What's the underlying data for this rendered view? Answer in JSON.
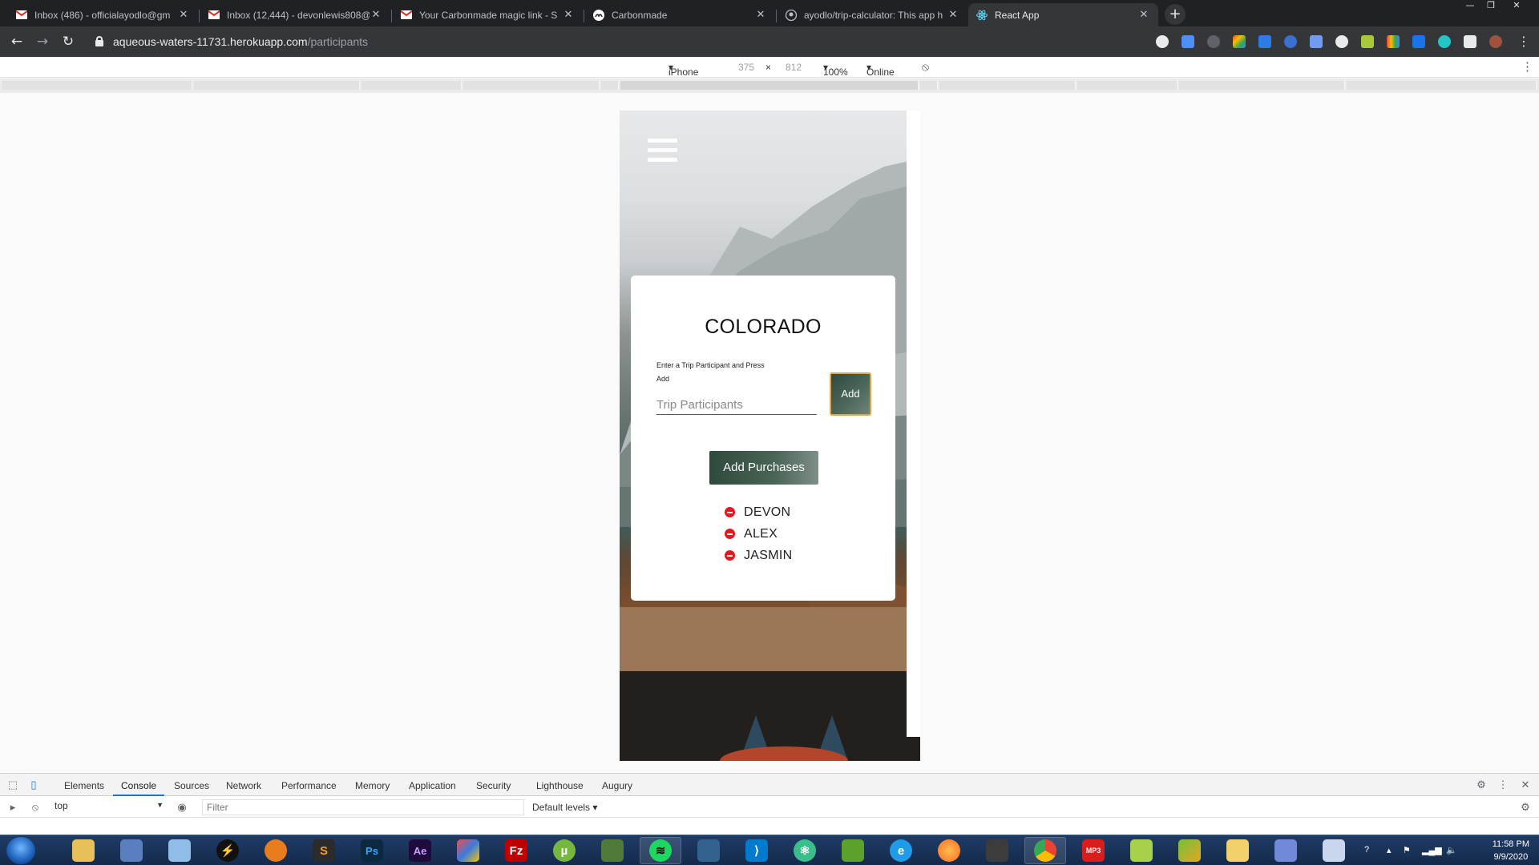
{
  "browser": {
    "tabs": [
      {
        "title": "Inbox (486) - officialayodlo@gm",
        "favicon": "gmail-icon",
        "active": false
      },
      {
        "title": "Inbox (12,444) - devonlewis808@",
        "favicon": "gmail-icon",
        "active": false
      },
      {
        "title": "Your Carbonmade magic link - S",
        "favicon": "gmail-icon",
        "active": false
      },
      {
        "title": "Carbonmade",
        "favicon": "carbonmade-icon",
        "active": false
      },
      {
        "title": "ayodlo/trip-calculator: This app h",
        "favicon": "github-icon",
        "active": false
      },
      {
        "title": "React App",
        "favicon": "react-icon",
        "active": true
      }
    ],
    "url_host": "aqueous-waters-11731.herokuapp.com",
    "url_path": "/participants"
  },
  "device_toolbar": {
    "device": "iPhone X",
    "width": "375",
    "times": "×",
    "height": "812",
    "zoom": "100%",
    "network": "Online"
  },
  "app": {
    "title": "COLORADO",
    "instructions": "Enter a Trip Participant and Press Add",
    "input_placeholder": "Trip Participants",
    "add_label": "Add",
    "purchases_label": "Add Purchases",
    "participants": [
      "DEVON",
      "ALEX",
      "JASMIN"
    ],
    "colors": {
      "button_green": "#2f4a3d",
      "add_border": "#e8a43a",
      "remove_red": "#e5171f"
    }
  },
  "devtools": {
    "tabs": [
      "Elements",
      "Console",
      "Sources",
      "Network",
      "Performance",
      "Memory",
      "Application",
      "Security",
      "Lighthouse",
      "Augury"
    ],
    "active_tab": "Console",
    "context": "top",
    "filter_placeholder": "Filter",
    "levels": "Default levels"
  },
  "taskbar": {
    "time": "11:58 PM",
    "date": "9/9/2020"
  }
}
